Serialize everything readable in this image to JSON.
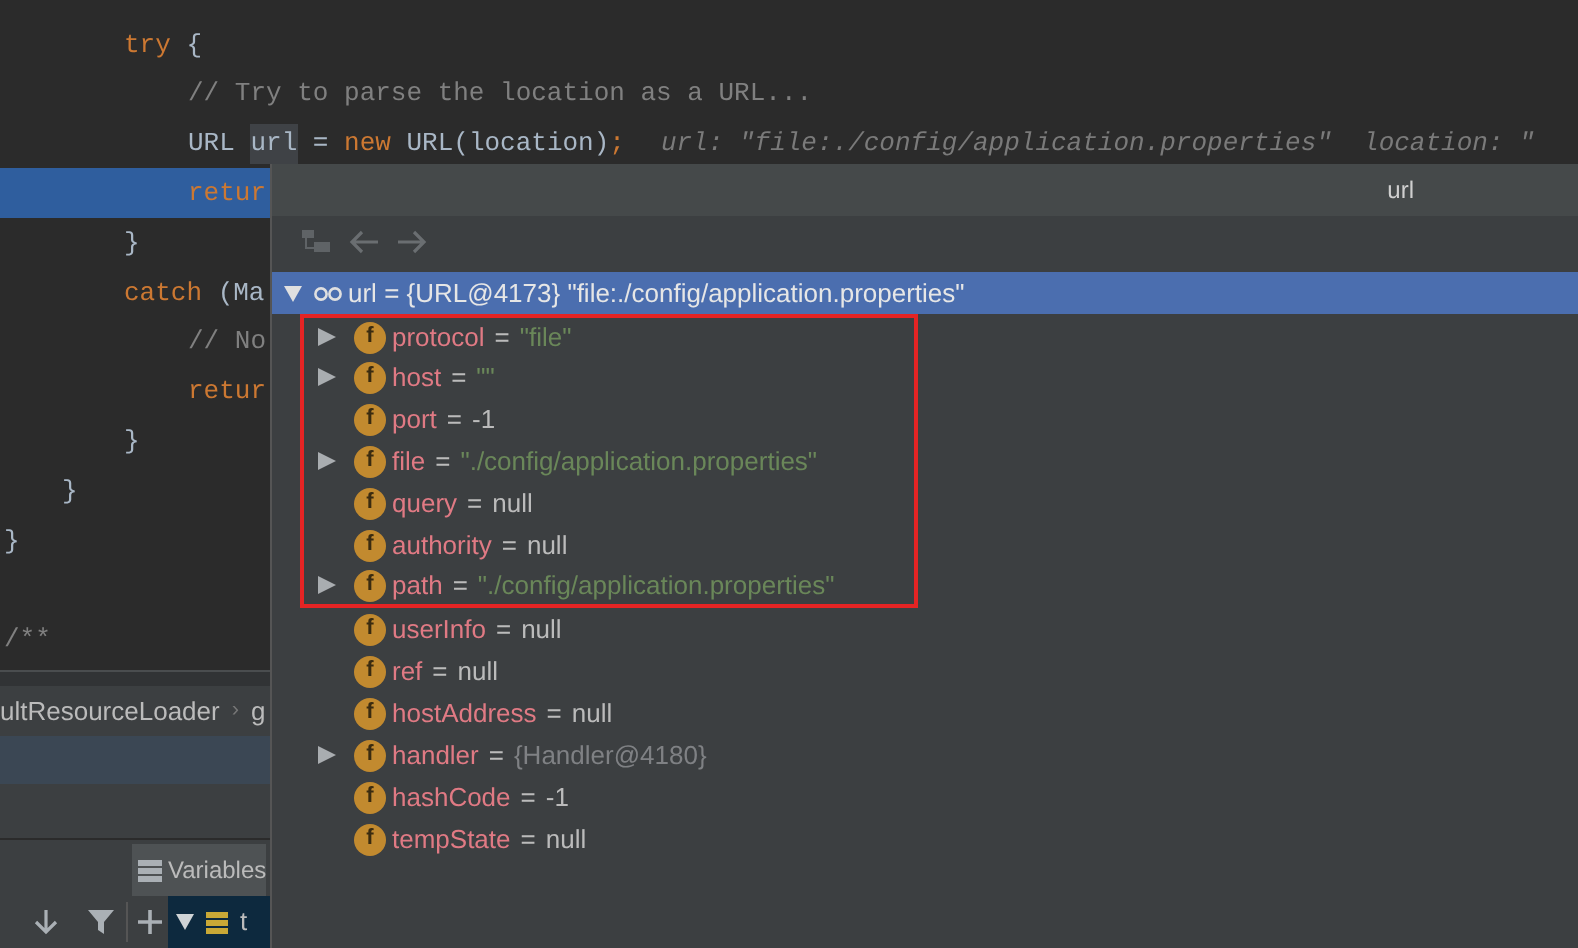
{
  "editor": {
    "lines": [
      {
        "children": [
          {
            "children": [
              {
                "segments": [
                  {
                    "kind": "keyword",
                    "text": "try"
                  },
                  {
                    "kind": "plain",
                    "text": " {"
                  }
                ],
                "children": [
                  {
                    "segments": [
                      {
                        "kind": "comment",
                        "text": "// Try to parse the location as a URL..."
                      }
                    ]
                  },
                  {
                    "segments": [
                      {
                        "kind": "plain",
                        "text": "URL "
                      },
                      {
                        "kind": "usage",
                        "text": "url"
                      },
                      {
                        "kind": "plain",
                        "text": " = "
                      },
                      {
                        "kind": "keyword",
                        "text": "new"
                      },
                      {
                        "kind": "plain",
                        "text": " URL(location)"
                      },
                      {
                        "kind": "keyword",
                        "text": ";"
                      },
                      {
                        "kind": "hint",
                        "text": "url: \"file:./config/application.properties\"  location: \""
                      }
                    ]
                  },
                  {
                    "current": true,
                    "segments": [
                      {
                        "kind": "keyword",
                        "text": "retur"
                      }
                    ]
                  }
                ]
              },
              {
                "segments": [
                  {
                    "kind": "plain",
                    "text": "}"
                  }
                ]
              },
              {
                "segments": [
                  {
                    "kind": "keyword",
                    "text": "catch"
                  },
                  {
                    "kind": "plain",
                    "text": " (Ma"
                  }
                ],
                "children": [
                  {
                    "segments": [
                      {
                        "kind": "comment",
                        "text": "// No"
                      }
                    ]
                  },
                  {
                    "segments": [
                      {
                        "kind": "keyword",
                        "text": "retur"
                      }
                    ]
                  }
                ]
              },
              {
                "segments": [
                  {
                    "kind": "plain",
                    "text": "}"
                  }
                ]
              }
            ]
          },
          {
            "segments": [
              {
                "kind": "plain",
                "text": "}"
              }
            ]
          }
        ]
      },
      {
        "segments": [
          {
            "kind": "plain",
            "text": "}"
          }
        ]
      },
      {
        "blank": true
      },
      {
        "segments": [
          {
            "kind": "comment",
            "text": "/**"
          }
        ]
      }
    ]
  },
  "bottom_panel": {
    "breadcrumb": [
      "ultResourceLoader",
      "g"
    ],
    "breadcrumb_separator": "›",
    "tabs": [
      {
        "label": "Variables",
        "selected": true
      }
    ],
    "frames": [
      {
        "label": "t",
        "expanded": true,
        "selected": true
      }
    ]
  },
  "popup": {
    "title": "url",
    "root": {
      "expanded": true,
      "selected": true,
      "name": "url",
      "op": "=",
      "value": "{URL@4173} \"file:./config/application.properties\""
    },
    "fields": [
      {
        "badge": "f",
        "name": "protocol",
        "op": "=",
        "value": "\"file\"",
        "kind": "string",
        "expandable": true,
        "highlighted": true
      },
      {
        "badge": "f",
        "name": "host",
        "op": "=",
        "value": "\"\"",
        "kind": "string",
        "expandable": true,
        "highlighted": true
      },
      {
        "badge": "f",
        "name": "port",
        "op": "=",
        "value": "-1",
        "kind": "plain",
        "expandable": false,
        "highlighted": true
      },
      {
        "badge": "f",
        "name": "file",
        "op": "=",
        "value": "\"./config/application.properties\"",
        "kind": "string",
        "expandable": true,
        "highlighted": true
      },
      {
        "badge": "f",
        "name": "query",
        "op": "=",
        "value": "null",
        "kind": "plain",
        "expandable": false,
        "highlighted": true
      },
      {
        "badge": "f",
        "name": "authority",
        "op": "=",
        "value": "null",
        "kind": "plain",
        "expandable": false,
        "highlighted": true
      },
      {
        "badge": "f",
        "name": "path",
        "op": "=",
        "value": "\"./config/application.properties\"",
        "kind": "string",
        "expandable": true,
        "highlighted": true
      },
      {
        "badge": "f",
        "name": "userInfo",
        "op": "=",
        "value": "null",
        "kind": "plain",
        "expandable": false,
        "highlighted": false
      },
      {
        "badge": "f",
        "name": "ref",
        "op": "=",
        "value": "null",
        "kind": "plain",
        "expandable": false,
        "highlighted": false
      },
      {
        "badge": "f",
        "name": "hostAddress",
        "op": "=",
        "value": "null",
        "kind": "plain",
        "expandable": false,
        "highlighted": false
      },
      {
        "badge": "f",
        "name": "handler",
        "op": "=",
        "value": "{Handler@4180}",
        "kind": "reference",
        "expandable": true,
        "highlighted": false
      },
      {
        "badge": "f",
        "name": "hashCode",
        "op": "=",
        "value": "-1",
        "kind": "plain",
        "expandable": false,
        "highlighted": false
      },
      {
        "badge": "f",
        "name": "tempState",
        "op": "=",
        "value": "null",
        "kind": "plain",
        "expandable": false,
        "highlighted": false
      }
    ]
  }
}
